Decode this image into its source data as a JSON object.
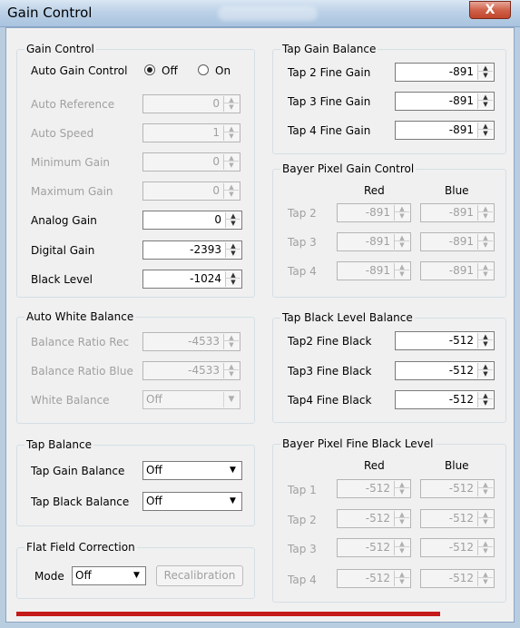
{
  "window": {
    "title": "Gain Control",
    "close_glyph": "X"
  },
  "gain_control": {
    "title": "Gain Control",
    "auto_gain_label": "Auto Gain Control",
    "auto_gain_off": "Off",
    "auto_gain_on": "On",
    "auto_gain_selected": "Off",
    "rows": [
      {
        "label": "Auto Reference",
        "value": "0",
        "enabled": false
      },
      {
        "label": "Auto Speed",
        "value": "1",
        "enabled": false
      },
      {
        "label": "Minimum Gain",
        "value": "0",
        "enabled": false
      },
      {
        "label": "Maximum Gain",
        "value": "0",
        "enabled": false
      },
      {
        "label": "Analog Gain",
        "value": "0",
        "enabled": true
      },
      {
        "label": "Digital Gain",
        "value": "-2393",
        "enabled": true
      },
      {
        "label": "Black Level",
        "value": "-1024",
        "enabled": true
      }
    ]
  },
  "auto_white_balance": {
    "title": "Auto White Balance",
    "ratio_red_label": "Balance Ratio Rec",
    "ratio_red_value": "-4533",
    "ratio_blue_label": "Balance Ratio Blue",
    "ratio_blue_value": "-4533",
    "white_balance_label": "White Balance",
    "white_balance_value": "Off"
  },
  "tap_balance": {
    "title": "Tap Balance",
    "gain_label": "Tap Gain Balance",
    "gain_value": "Off",
    "black_label": "Tap Black Balance",
    "black_value": "Off"
  },
  "flat_field": {
    "title": "Flat Field Correction",
    "mode_label": "Mode",
    "mode_value": "Off",
    "recalibration_label": "Recalibration"
  },
  "tap_gain_balance": {
    "title": "Tap Gain Balance",
    "rows": [
      {
        "label": "Tap 2 Fine Gain",
        "value": "-891"
      },
      {
        "label": "Tap 3 Fine Gain",
        "value": "-891"
      },
      {
        "label": "Tap 4 Fine Gain",
        "value": "-891"
      }
    ]
  },
  "bayer_gain": {
    "title": "Bayer Pixel Gain Control",
    "col_red": "Red",
    "col_blue": "Blue",
    "rows": [
      {
        "label": "Tap 2",
        "red": "-891",
        "blue": "-891"
      },
      {
        "label": "Tap 3",
        "red": "-891",
        "blue": "-891"
      },
      {
        "label": "Tap 4",
        "red": "-891",
        "blue": "-891"
      }
    ]
  },
  "tap_black_balance": {
    "title": "Tap Black Level Balance",
    "rows": [
      {
        "label": "Tap2 Fine Black",
        "value": "-512"
      },
      {
        "label": "Tap3 Fine Black",
        "value": "-512"
      },
      {
        "label": "Tap4 Fine Black",
        "value": "-512"
      }
    ]
  },
  "bayer_black": {
    "title": "Bayer Pixel Fine Black Level",
    "col_red": "Red",
    "col_blue": "Blue",
    "rows": [
      {
        "label": "Tap 1",
        "red": "-512",
        "blue": "-512"
      },
      {
        "label": "Tap 2",
        "red": "-512",
        "blue": "-512"
      },
      {
        "label": "Tap 3",
        "red": "-512",
        "blue": "-512"
      },
      {
        "label": "Tap 4",
        "red": "-512",
        "blue": "-512"
      }
    ]
  },
  "icons": {
    "spin_up": "▲",
    "spin_down": "▼",
    "dropdown": "▼"
  },
  "colors": {
    "progress": "#c41a1a",
    "close_button": "#c0462d"
  }
}
